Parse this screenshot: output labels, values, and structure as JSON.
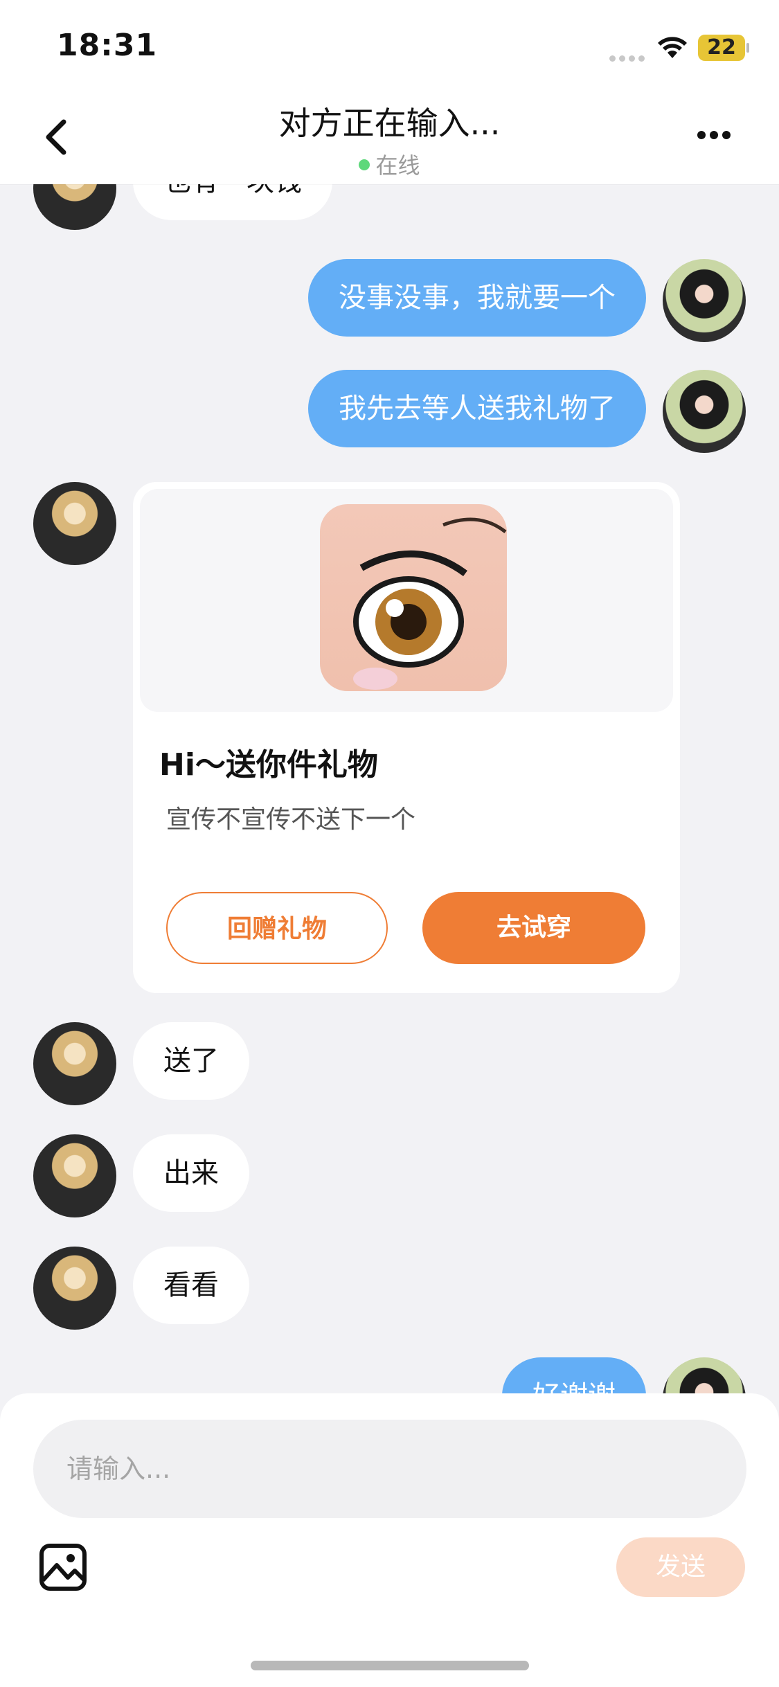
{
  "status_bar": {
    "time": "18:31",
    "battery": "22"
  },
  "header": {
    "title": "对方正在输入...",
    "status": "在线",
    "online_color": "#5dd87a"
  },
  "messages": [
    {
      "side": "in",
      "text": "也有一块钱"
    },
    {
      "side": "out",
      "text": "没事没事，我就要一个"
    },
    {
      "side": "out",
      "text": "我先去等人送我礼物了"
    },
    {
      "side": "in",
      "type": "gift_card",
      "title": "Hi～送你件礼物",
      "subtitle": "宣传不宣传不送下一个",
      "return_button": "回赠礼物",
      "try_button": "去试穿"
    },
    {
      "side": "in",
      "text": "送了"
    },
    {
      "side": "in",
      "text": "出来"
    },
    {
      "side": "in",
      "text": "看看"
    },
    {
      "side": "out",
      "text": "好谢谢"
    }
  ],
  "input": {
    "placeholder": "请输入...",
    "value": ""
  },
  "send_button": "发送",
  "icons": {
    "back": "chevron-left-icon",
    "more": "more-dots-icon",
    "image": "image-icon",
    "wifi": "wifi-icon"
  },
  "colors": {
    "accent": "#ef7d35",
    "outgoing_bubble": "#63aef6",
    "send_disabled": "#fbd9c6"
  }
}
